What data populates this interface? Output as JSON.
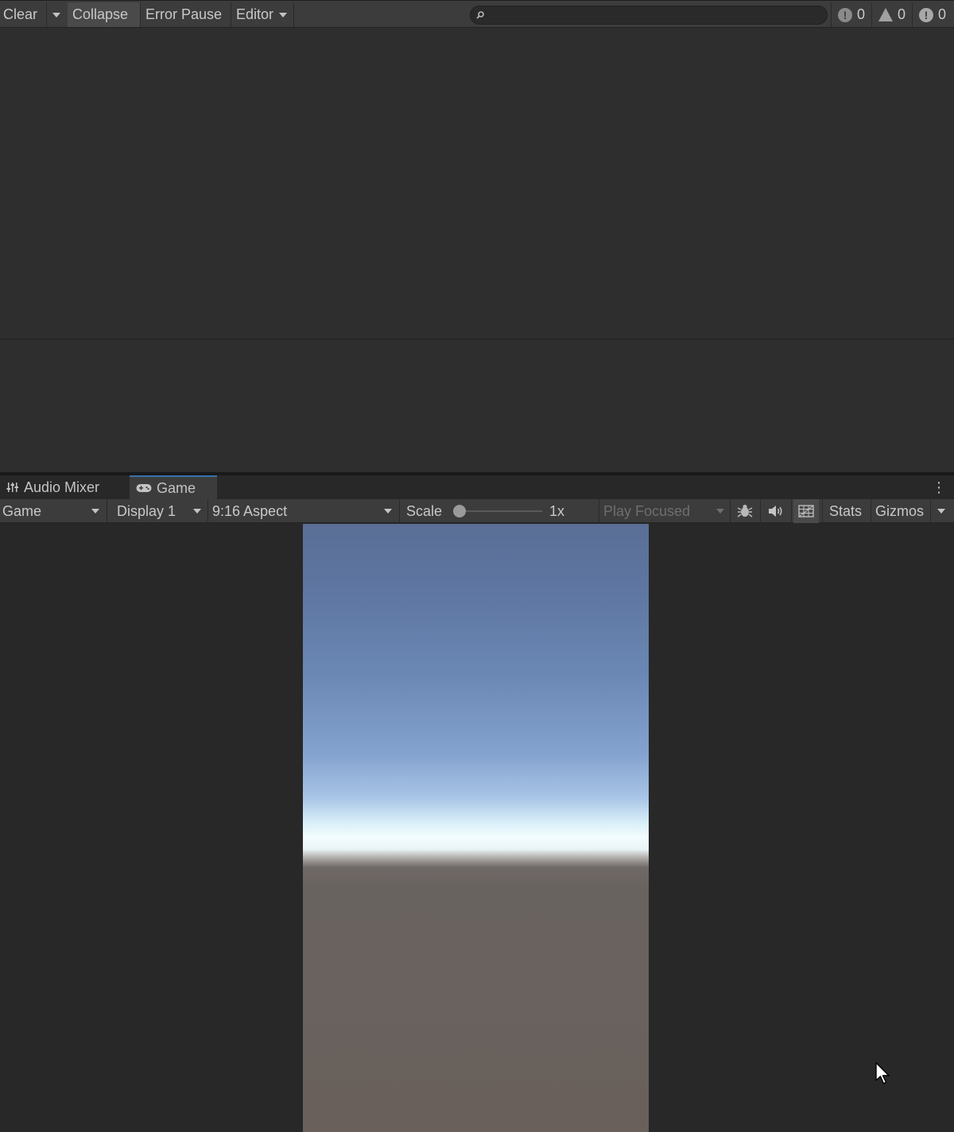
{
  "console": {
    "toolbar": {
      "clear_label": "Clear",
      "collapse_label": "Collapse",
      "error_pause_label": "Error Pause",
      "editor_label": "Editor",
      "search_value": "",
      "log_count": "0",
      "warning_count": "0",
      "error_count": "0"
    }
  },
  "tabs": [
    {
      "label": "Audio Mixer",
      "icon": "sliders-icon"
    },
    {
      "label": "Game",
      "icon": "gamepad-icon",
      "active": true
    }
  ],
  "game_toolbar": {
    "view_select": "Game",
    "display_select": "Display 1",
    "aspect_select": "9:16 Aspect",
    "scale_label": "Scale",
    "scale_value": "1x",
    "play_mode_select": "Play Focused",
    "stats_label": "Stats",
    "gizmos_label": "Gizmos"
  },
  "colors": {
    "panel_bg": "#282828",
    "toolbar_bg": "#3c3c3c",
    "sky_top": "#5a6f96",
    "horizon": "#f3fdff",
    "ground": "#69605b"
  }
}
